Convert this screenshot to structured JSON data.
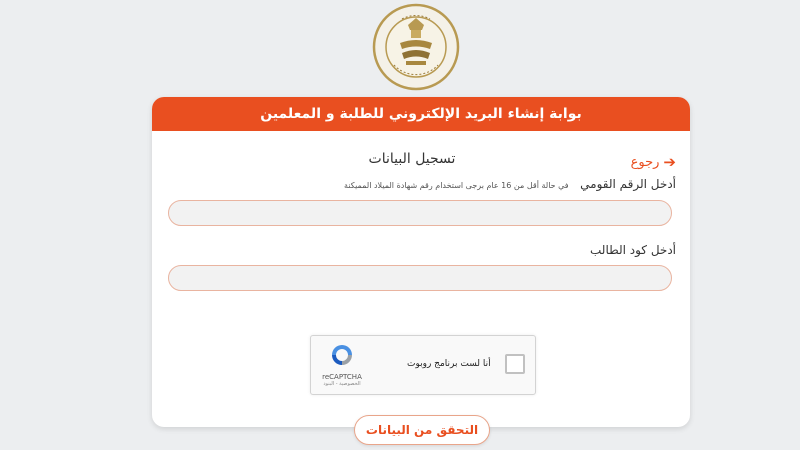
{
  "header": {
    "title": "بوابة إنشاء البريد الإلكتروني للطلبة و المعلمين"
  },
  "logo": {
    "text": "MINISTRY OF EDUCATION AND TECHNICAL EDUCATION"
  },
  "form": {
    "back_label": "رجوع",
    "title": "تسجيل البيانات",
    "national_id_label": "أدخل الرقم القومي",
    "national_id_hint": "في حالة أقل من 16 عام برجى استخدام رقم شهادة الميلاد المميكنة",
    "national_id_value": "",
    "student_code_label": "أدخل كود الطالب",
    "student_code_value": "",
    "captcha_label": "أنا لست برنامج روبوت",
    "captcha_brand": "reCAPTCHA",
    "captcha_terms": "الخصوصية - البنود",
    "submit_label": "التحقق من البيانات"
  },
  "colors": {
    "accent": "#e94f20",
    "background": "#eceef0",
    "input_border": "#e9b4a0"
  }
}
